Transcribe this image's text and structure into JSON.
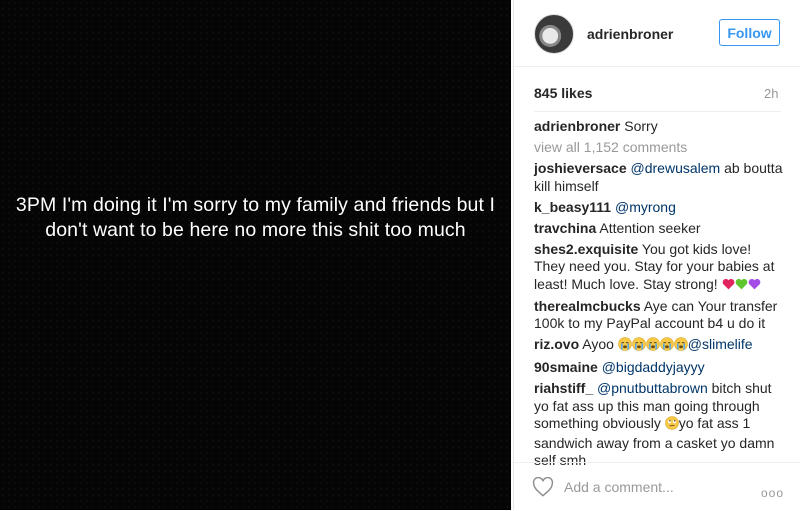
{
  "post": {
    "image_text": "3PM I'm doing it I'm sorry to my family and friends but I don't want to be here no more this shit too much"
  },
  "header": {
    "username": "adrienbroner",
    "follow_label": "Follow"
  },
  "stats": {
    "likes": "845 likes",
    "time_ago": "2h"
  },
  "caption": {
    "username": "adrienbroner",
    "text": "Sorry"
  },
  "view_all_comments": "view all 1,152 comments",
  "comments": [
    {
      "user": "joshieversace",
      "mention": "@drewusalem",
      "text": " ab boutta kill himself"
    },
    {
      "user": "k_beasy111",
      "mention": "@myrong",
      "text": ""
    },
    {
      "user": "travchina",
      "text": " Attention seeker"
    },
    {
      "user": "shes2.exquisite",
      "text": " You got kids love! They need you. Stay for your babies at least! Much love. Stay strong!",
      "emoji": [
        "red-heart",
        "green-heart",
        "purple-heart"
      ]
    },
    {
      "user": "therealmcbucks",
      "text": " Aye can Your transfer 100k to my PayPal account b4 u do it"
    },
    {
      "user": "riz.ovo",
      "text": " Ayoo ",
      "emoji": [
        "crying-face",
        "crying-face",
        "crying-face",
        "crying-face",
        "crying-face"
      ],
      "mention": "@slimelife"
    },
    {
      "user": "90smaine",
      "mention": "@bigdaddyjayyy",
      "text": ""
    },
    {
      "user": "riahstiff_",
      "mention": "@pnutbuttabrown",
      "text_before": " bitch shut yo fat ass up this man going through something obviously ",
      "emoji": [
        "eye-roll-face"
      ],
      "text_after": "yo fat ass 1 sandwich away from a casket yo damn self smh"
    }
  ],
  "footer": {
    "placeholder": "Add a comment...",
    "more": "ooo"
  },
  "colors": {
    "accent": "#3897f0",
    "mention": "#003569",
    "muted": "#999999",
    "text": "#262626"
  }
}
